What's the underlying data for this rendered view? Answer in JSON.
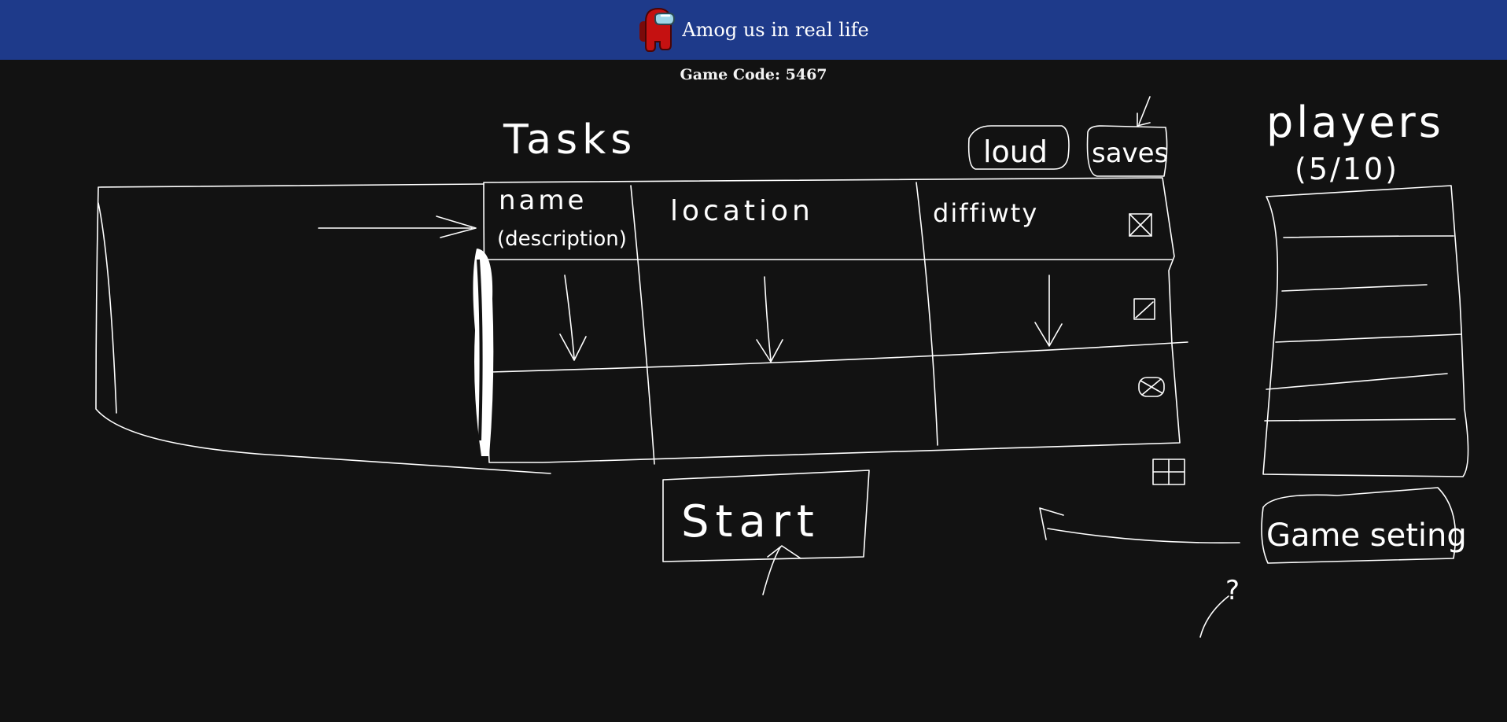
{
  "header": {
    "title": "Amog us in real life",
    "icon": "crewmate-icon",
    "background": "#1e3a8a",
    "crewmate_color": "#c51111"
  },
  "game": {
    "code_label": "Game Code: 5467"
  },
  "sketch": {
    "tasks_title": "Tasks",
    "load_button": "loud",
    "saves_button": "saves",
    "columns": [
      "name",
      "(description)",
      "location",
      "diffiwty"
    ],
    "players_title": "players",
    "players_count": "(5/10)",
    "start_button": "Start",
    "settings_button": "Game seting",
    "question_mark": "?"
  },
  "colors": {
    "background": "#121212",
    "ink": "#ffffff"
  }
}
